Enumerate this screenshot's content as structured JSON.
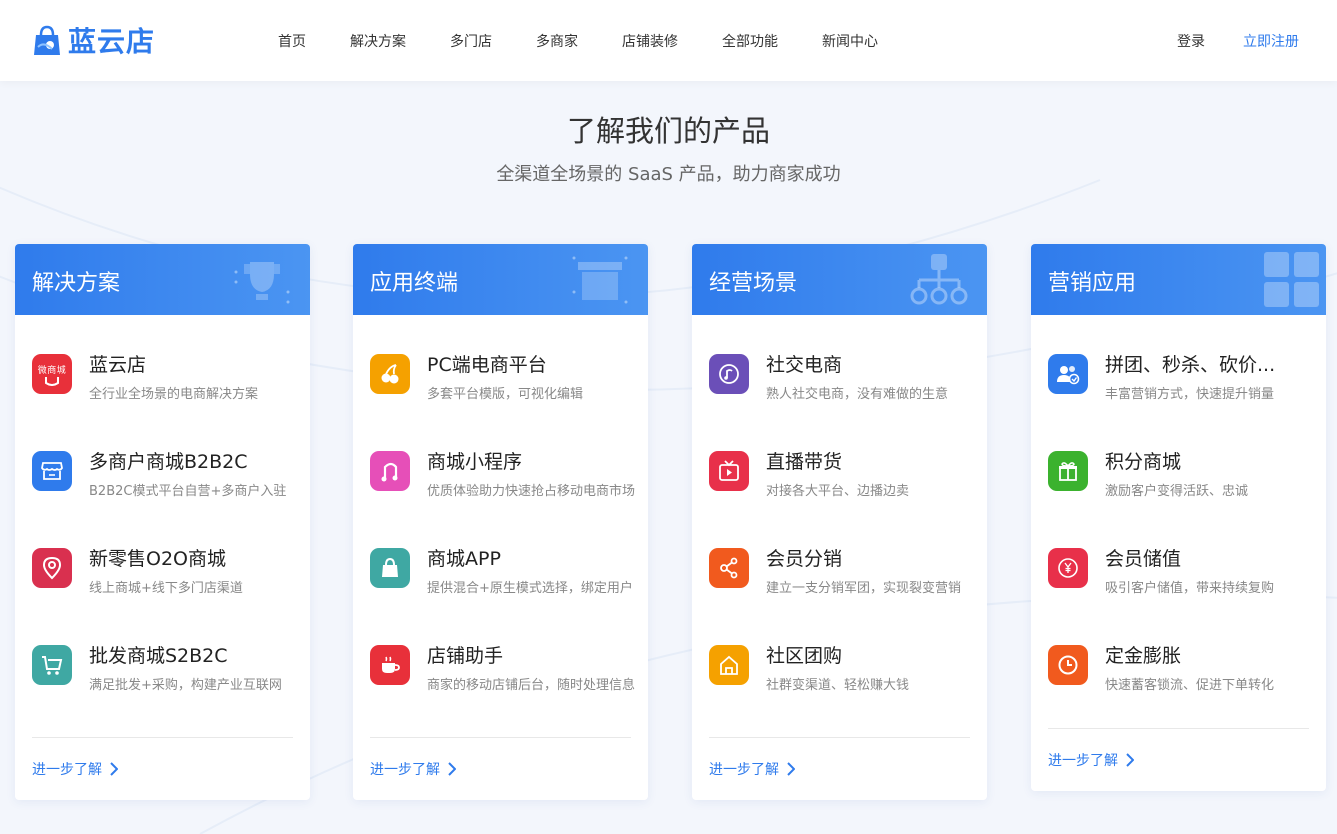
{
  "brand": {
    "name": "蓝云店",
    "color": "#2f7bec"
  },
  "nav": {
    "items": [
      "首页",
      "解决方案",
      "多门店",
      "多商家",
      "店铺装修",
      "全部功能",
      "新闻中心"
    ],
    "login": "登录",
    "register": "立即注册"
  },
  "hero": {
    "title": "了解我们的产品",
    "subtitle": "全渠道全场景的 SaaS 产品，助力商家成功"
  },
  "cards": [
    {
      "title": "解决方案",
      "items": [
        {
          "title": "蓝云店",
          "desc": "全行业全场景的电商解决方案",
          "icon": "wei-mall-icon",
          "badge": "微商城",
          "color": "#e8303a"
        },
        {
          "title": "多商户商城B2B2C",
          "desc": "B2B2C模式平台自营+多商户入驻",
          "icon": "store-icon",
          "color": "#2f7bec"
        },
        {
          "title": "新零售O2O商城",
          "desc": "线上商城+线下多门店渠道",
          "icon": "location-pin-icon",
          "color": "#d9304f"
        },
        {
          "title": "批发商城S2B2C",
          "desc": "满足批发+采购，构建产业互联网",
          "icon": "cart-icon",
          "color": "#3fa8a3"
        }
      ],
      "more": "进一步了解"
    },
    {
      "title": "应用终端",
      "items": [
        {
          "title": "PC端电商平台",
          "desc": "多套平台模版，可视化编辑",
          "icon": "cherry-icon",
          "color": "#f5a100"
        },
        {
          "title": "商城小程序",
          "desc": "优质体验助力快速抢占移动电商市场",
          "icon": "music-note-icon",
          "color": "#e64fb8"
        },
        {
          "title": "商城APP",
          "desc": "提供混合+原生模式选择，绑定用户",
          "icon": "shopping-bag-icon",
          "color": "#3fa8a3"
        },
        {
          "title": "店铺助手",
          "desc": "商家的移动店铺后台，随时处理信息",
          "icon": "coffee-cup-icon",
          "color": "#e8303a"
        }
      ],
      "more": "进一步了解"
    },
    {
      "title": "经营场景",
      "items": [
        {
          "title": "社交电商",
          "desc": "熟人社交电商，没有难做的生意",
          "icon": "music-circle-icon",
          "color": "#6b4fb8"
        },
        {
          "title": "直播带货",
          "desc": "对接各大平台、边播边卖",
          "icon": "tv-play-icon",
          "color": "#e8304a"
        },
        {
          "title": "会员分销",
          "desc": "建立一支分销军团，实现裂变营销",
          "icon": "share-network-icon",
          "color": "#f15a1e"
        },
        {
          "title": "社区团购",
          "desc": "社群变渠道、轻松赚大钱",
          "icon": "house-icon",
          "color": "#f5a100"
        }
      ],
      "more": "进一步了解"
    },
    {
      "title": "营销应用",
      "items": [
        {
          "title": "拼团、秒杀、砍价...",
          "desc": "丰富营销方式，快速提升销量",
          "icon": "group-users-icon",
          "color": "#2f7bec"
        },
        {
          "title": "积分商城",
          "desc": "激励客户变得活跃、忠诚",
          "icon": "gift-icon",
          "color": "#3bb22e"
        },
        {
          "title": "会员储值",
          "desc": "吸引客户储值，带来持续复购",
          "icon": "yen-coin-icon",
          "color": "#e8304a"
        },
        {
          "title": "定金膨胀",
          "desc": "快速蓄客锁流、促进下单转化",
          "icon": "clock-icon",
          "color": "#f15a1e"
        }
      ],
      "more": "进一步了解"
    }
  ]
}
